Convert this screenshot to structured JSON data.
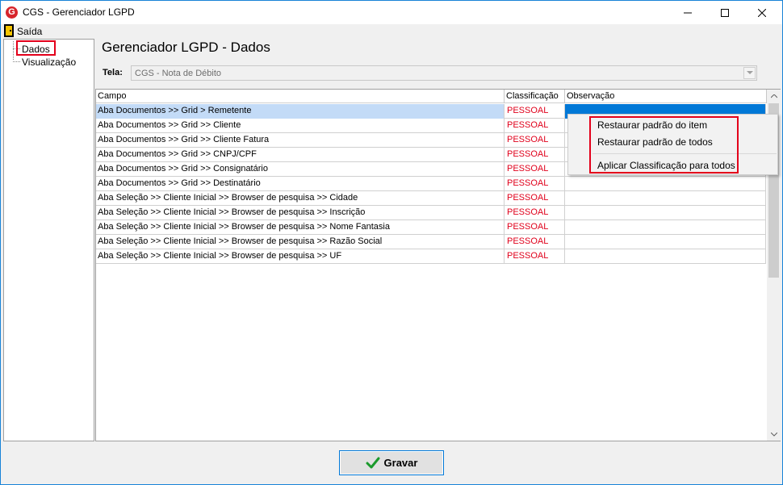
{
  "window": {
    "title": "CGS - Gerenciador LGPD",
    "app_icon_letter": "G"
  },
  "menu": {
    "saida_label": "Saída"
  },
  "tree": {
    "items": [
      {
        "label": "Dados",
        "selected": true
      },
      {
        "label": "Visualização",
        "selected": false
      }
    ]
  },
  "page": {
    "title": "Gerenciador LGPD - Dados",
    "tela_label": "Tela:",
    "tela_value": "CGS - Nota de Débito"
  },
  "grid": {
    "columns": [
      "Campo",
      "Classificação",
      "Observação"
    ],
    "rows": [
      {
        "campo": "Aba Documentos >> Grid > Remetente",
        "classificacao": "PESSOAL",
        "observacao": ""
      },
      {
        "campo": "Aba Documentos >> Grid >> Cliente",
        "classificacao": "PESSOAL",
        "observacao": ""
      },
      {
        "campo": "Aba Documentos >> Grid >> Cliente Fatura",
        "classificacao": "PESSOAL",
        "observacao": ""
      },
      {
        "campo": "Aba Documentos >> Grid >> CNPJ/CPF",
        "classificacao": "PESSOAL",
        "observacao": ""
      },
      {
        "campo": "Aba Documentos >> Grid >> Consignatário",
        "classificacao": "PESSOAL",
        "observacao": ""
      },
      {
        "campo": "Aba Documentos >> Grid >> Destinatário",
        "classificacao": "PESSOAL",
        "observacao": ""
      },
      {
        "campo": "Aba Seleção >> Cliente Inicial >> Browser de pesquisa >> Cidade",
        "classificacao": "PESSOAL",
        "observacao": ""
      },
      {
        "campo": "Aba Seleção >> Cliente Inicial >> Browser de pesquisa >> Inscrição",
        "classificacao": "PESSOAL",
        "observacao": ""
      },
      {
        "campo": "Aba Seleção >> Cliente Inicial >> Browser de pesquisa >> Nome Fantasia",
        "classificacao": "PESSOAL",
        "observacao": ""
      },
      {
        "campo": "Aba Seleção >> Cliente Inicial >> Browser de pesquisa >> Razão Social",
        "classificacao": "PESSOAL",
        "observacao": ""
      },
      {
        "campo": "Aba Seleção >> Cliente Inicial >> Browser de pesquisa >> UF",
        "classificacao": "PESSOAL",
        "observacao": ""
      }
    ]
  },
  "context_menu": {
    "items": [
      "Restaurar padrão do item",
      "Restaurar padrão de todos",
      "Aplicar Classificação para todos"
    ]
  },
  "footer": {
    "gravar_label": "Gravar"
  },
  "colors": {
    "accent": "#0078d7",
    "pessoal_text": "#e0001b",
    "highlight_box": "#e3001b",
    "selected_row": "#c3dbf7"
  }
}
